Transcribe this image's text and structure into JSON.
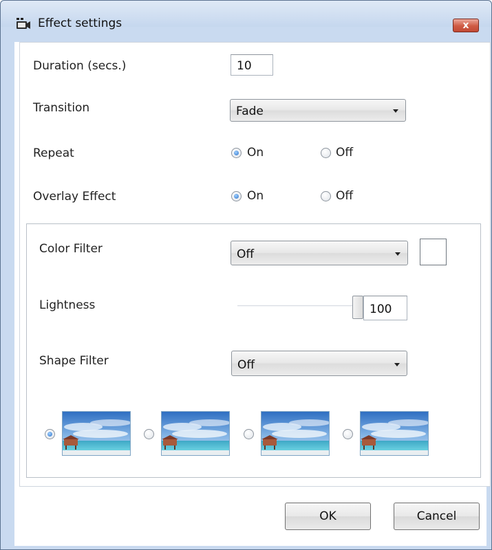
{
  "window": {
    "title": "Effect settings",
    "close_label": "x"
  },
  "fields": {
    "duration": {
      "label": "Duration (secs.)",
      "value": "10"
    },
    "transition": {
      "label": "Transition",
      "selected": "Fade"
    },
    "repeat": {
      "label": "Repeat",
      "on_label": "On",
      "off_label": "Off",
      "selected": "On"
    },
    "overlay": {
      "label": "Overlay Effect",
      "on_label": "On",
      "off_label": "Off",
      "selected": "On"
    }
  },
  "overlay_group": {
    "color_filter": {
      "label": "Color Filter",
      "selected": "Off",
      "swatch_color": "#ffffff"
    },
    "lightness": {
      "label": "Lightness",
      "value": "100",
      "level": 1.0
    },
    "shape_filter": {
      "label": "Shape Filter",
      "selected": "Off"
    },
    "shape_thumbnails": [
      {
        "selected": true,
        "icon": "beach-hut-image"
      },
      {
        "selected": false,
        "icon": "beach-hut-image"
      },
      {
        "selected": false,
        "icon": "beach-hut-image"
      },
      {
        "selected": false,
        "icon": "beach-hut-image"
      }
    ]
  },
  "buttons": {
    "ok": "OK",
    "cancel": "Cancel"
  },
  "colors": {
    "accent": "#2f73c9",
    "titlebar": "#c9daf0",
    "close": "#cf5a44"
  }
}
